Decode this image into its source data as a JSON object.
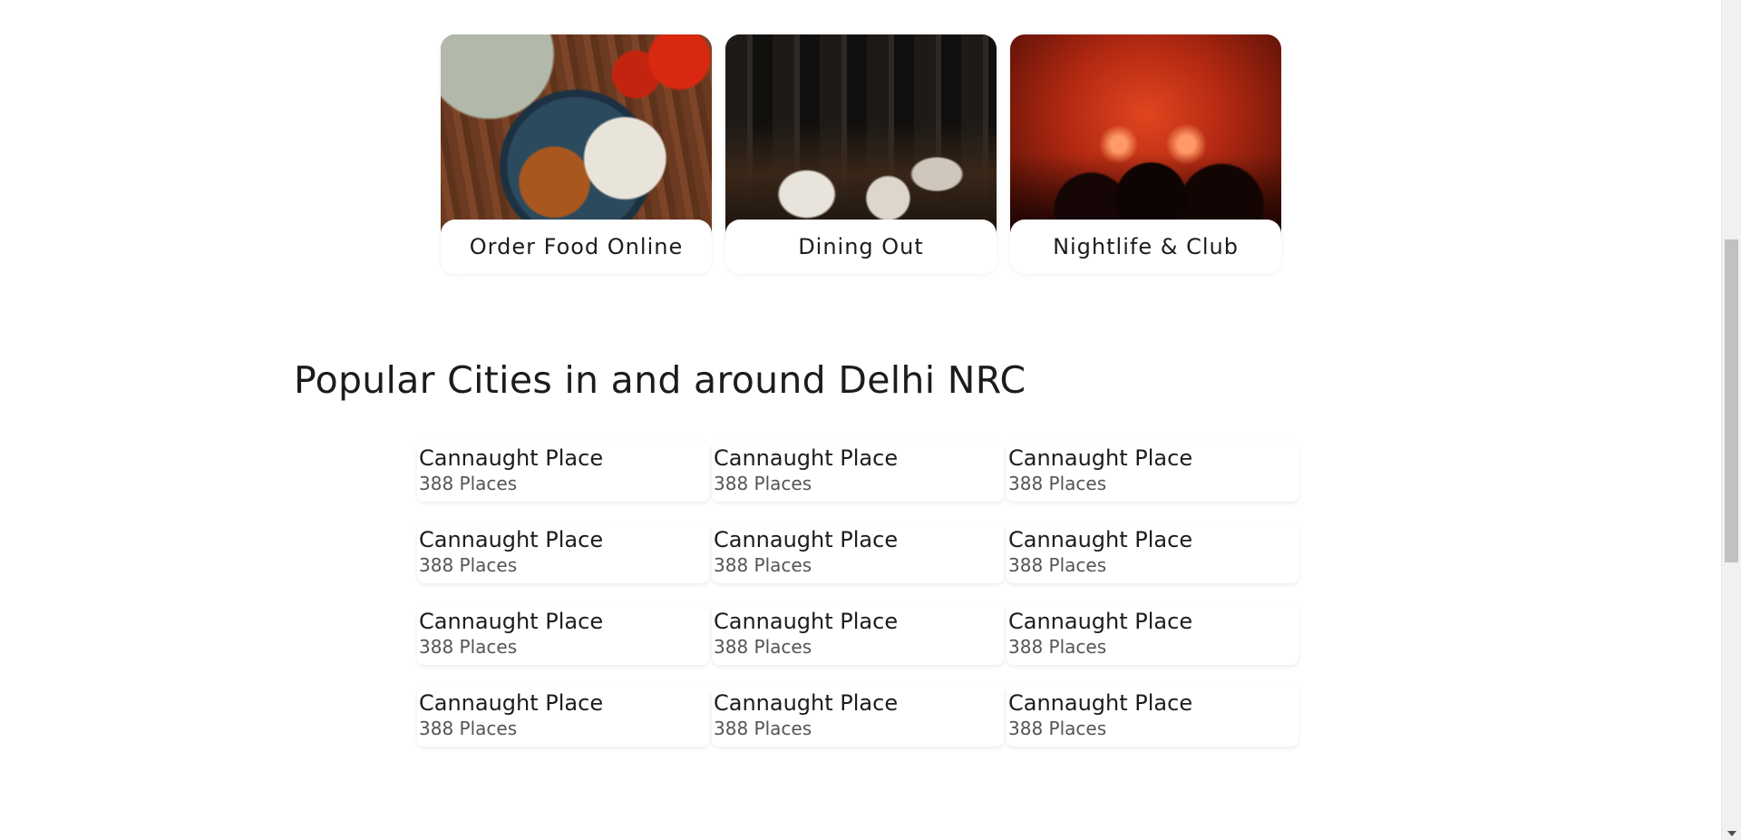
{
  "categories": [
    {
      "label": "Order Food Online"
    },
    {
      "label": "Dining Out"
    },
    {
      "label": "Nightlife & Club"
    }
  ],
  "section_title": "Popular Cities in and around Delhi NRC",
  "cities": [
    {
      "name": "Cannaught Place",
      "count": "388 Places"
    },
    {
      "name": "Cannaught Place",
      "count": "388 Places"
    },
    {
      "name": "Cannaught Place",
      "count": "388 Places"
    },
    {
      "name": "Cannaught Place",
      "count": "388 Places"
    },
    {
      "name": "Cannaught Place",
      "count": "388 Places"
    },
    {
      "name": "Cannaught Place",
      "count": "388 Places"
    },
    {
      "name": "Cannaught Place",
      "count": "388 Places"
    },
    {
      "name": "Cannaught Place",
      "count": "388 Places"
    },
    {
      "name": "Cannaught Place",
      "count": "388 Places"
    },
    {
      "name": "Cannaught Place",
      "count": "388 Places"
    },
    {
      "name": "Cannaught Place",
      "count": "388 Places"
    },
    {
      "name": "Cannaught Place",
      "count": "388 Places"
    }
  ],
  "colors": {
    "text": "#1c1c1c",
    "muted": "#555555",
    "background": "#ffffff"
  }
}
